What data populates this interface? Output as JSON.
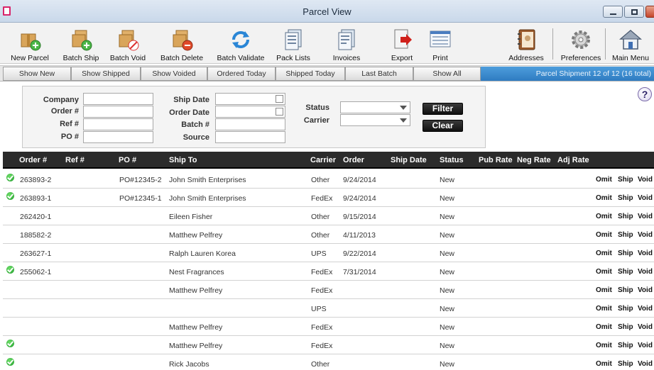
{
  "window": {
    "title": "Parcel View"
  },
  "toolbar": {
    "new_parcel": "New Parcel",
    "batch_ship": "Batch Ship",
    "batch_void": "Batch Void",
    "batch_delete": "Batch Delete",
    "batch_validate": "Batch Validate",
    "pack_lists": "Pack Lists",
    "invoices": "Invoices",
    "export": "Export",
    "print": "Print",
    "addresses": "Addresses",
    "preferences": "Preferences",
    "main_menu": "Main Menu"
  },
  "filters": {
    "show_new": "Show New",
    "show_shipped": "Show Shipped",
    "show_voided": "Show Voided",
    "ordered_today": "Ordered Today",
    "shipped_today": "Shipped Today",
    "last_batch": "Last Batch",
    "show_all": "Show All",
    "status_text": "Parcel Shipment 12 of 12 (16 total)"
  },
  "panel": {
    "company": "Company",
    "order_no": "Order #",
    "ref_no": "Ref #",
    "po_no": "PO #",
    "ship_date": "Ship Date",
    "order_date": "Order Date",
    "batch_no": "Batch #",
    "source": "Source",
    "status": "Status",
    "carrier": "Carrier",
    "filter_btn": "Filter",
    "clear_btn": "Clear",
    "help": "?"
  },
  "table": {
    "headers": {
      "order": "Order #",
      "ref": "Ref #",
      "po": "PO #",
      "ship_to": "Ship To",
      "carrier": "Carrier",
      "order_date": "Order",
      "ship_date": "Ship Date",
      "status": "Status",
      "pub_rate": "Pub Rate",
      "neg_rate": "Neg Rate",
      "adj_rate": "Adj Rate"
    },
    "actions": {
      "omit": "Omit",
      "ship": "Ship",
      "void": "Void"
    },
    "rows": [
      {
        "check": true,
        "order": "263893-2",
        "po": "PO#12345-2",
        "ship_to": "John Smith Enterprises",
        "carrier": "Other",
        "order_date": "9/24/2014",
        "status": "New"
      },
      {
        "check": true,
        "order": "263893-1",
        "po": "PO#12345-1",
        "ship_to": "John Smith Enterprises",
        "carrier": "FedEx",
        "order_date": "9/24/2014",
        "status": "New"
      },
      {
        "check": false,
        "order": "262420-1",
        "po": "",
        "ship_to": "Eileen Fisher",
        "carrier": "Other",
        "order_date": "9/15/2014",
        "status": "New"
      },
      {
        "check": false,
        "order": "188582-2",
        "po": "",
        "ship_to": "Matthew Pelfrey",
        "carrier": "Other",
        "order_date": "4/11/2013",
        "status": "New"
      },
      {
        "check": false,
        "order": "263627-1",
        "po": "",
        "ship_to": "Ralph Lauren Korea",
        "carrier": "UPS",
        "order_date": "9/22/2014",
        "status": "New"
      },
      {
        "check": true,
        "order": "255062-1",
        "po": "",
        "ship_to": "Nest Fragrances",
        "carrier": "FedEx",
        "order_date": "7/31/2014",
        "status": "New"
      },
      {
        "check": false,
        "order": "",
        "po": "",
        "ship_to": "Matthew Pelfrey",
        "carrier": "FedEx",
        "order_date": "",
        "status": "New"
      },
      {
        "check": false,
        "order": "",
        "po": "",
        "ship_to": "",
        "carrier": "UPS",
        "order_date": "",
        "status": "New"
      },
      {
        "check": false,
        "order": "",
        "po": "",
        "ship_to": "Matthew Pelfrey",
        "carrier": "FedEx",
        "order_date": "",
        "status": "New"
      },
      {
        "check": true,
        "order": "",
        "po": "",
        "ship_to": "Matthew Pelfrey",
        "carrier": "FedEx",
        "order_date": "",
        "status": "New"
      },
      {
        "check": true,
        "order": "",
        "po": "",
        "ship_to": "Rick Jacobs",
        "carrier": "Other",
        "order_date": "",
        "status": "New"
      }
    ]
  }
}
